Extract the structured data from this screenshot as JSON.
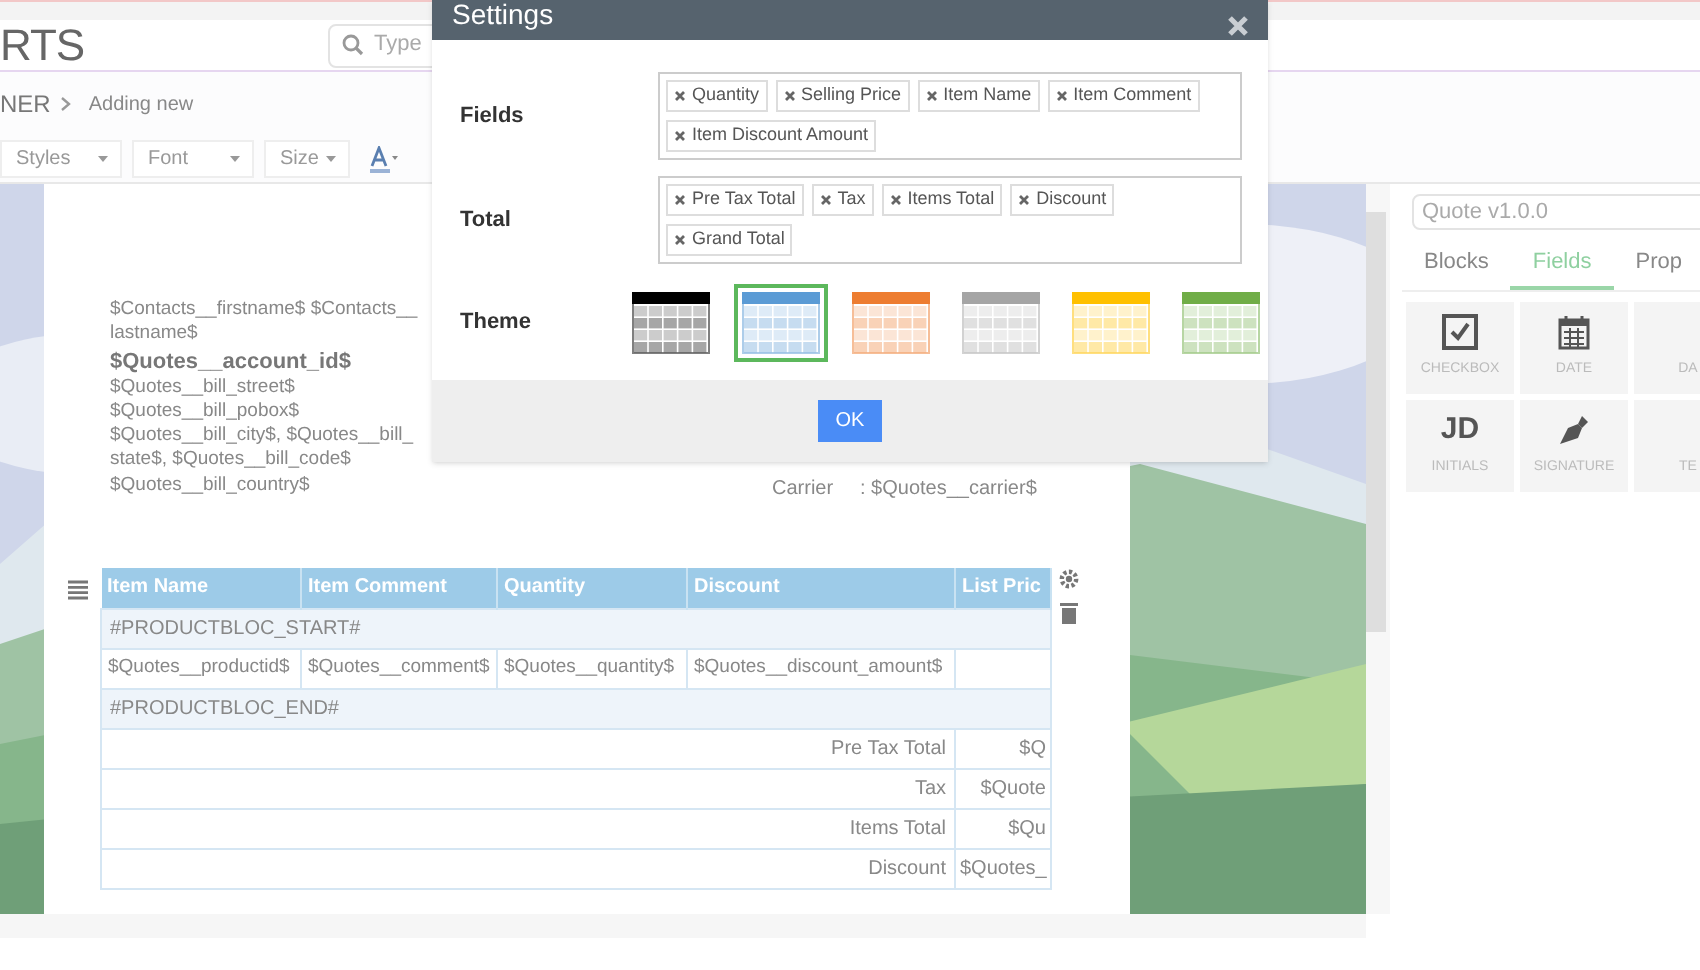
{
  "header": {
    "logo": "RTS",
    "search": {
      "placeholder": "Type"
    }
  },
  "breadcrumb": {
    "parent": "NER",
    "current": "Adding new"
  },
  "toolbar": {
    "dropdowns": [
      "Styles",
      "Font",
      "Size"
    ]
  },
  "document": {
    "address": [
      {
        "text": "$Contacts__firstname$ $Contacts__lastname$",
        "bold": false
      },
      {
        "text": "$Quotes__account_id$",
        "bold": true
      },
      {
        "text": "$Quotes__bill_street$",
        "bold": false
      },
      {
        "text": "$Quotes__bill_pobox$",
        "bold": false
      },
      {
        "text": "$Quotes__bill_city$, $Quotes__bill_state$, $Quotes__bill_code$",
        "bold": false
      },
      {
        "text": "$Quotes__bill_country$",
        "bold": false
      }
    ],
    "details": [
      {
        "label": "Carrier",
        "value": ": $Quotes__carrier$"
      }
    ],
    "table": {
      "columns": [
        "Item Name",
        "Item Comment",
        "Quantity",
        "Discount",
        "List Pric"
      ],
      "rows": [
        {
          "kind": "marker",
          "text": "#PRODUCTBLOC_START#"
        },
        {
          "kind": "data",
          "cells": [
            "$Quotes__productid$",
            "$Quotes__comment$",
            "$Quotes__quantity$",
            "$Quotes__discount_amount$"
          ]
        },
        {
          "kind": "marker",
          "text": "#PRODUCTBLOC_END#"
        },
        {
          "kind": "total",
          "label": "Pre Tax Total",
          "value": "$Q"
        },
        {
          "kind": "total",
          "label": "Tax",
          "value": "$Quote"
        },
        {
          "kind": "total",
          "label": "Items Total",
          "value": "$Qu"
        },
        {
          "kind": "total",
          "label": "Discount",
          "value": "$Quotes_"
        }
      ]
    }
  },
  "panel": {
    "template": "Quote v1.0.0",
    "tabs": [
      {
        "label": "Blocks",
        "selected": false
      },
      {
        "label": "Fields",
        "selected": true
      },
      {
        "label": "Prop",
        "selected": false
      }
    ],
    "tiles": [
      {
        "label": "CHECKBOX",
        "kind": "checkbox"
      },
      {
        "label": "DATE",
        "kind": "calendar"
      },
      {
        "label": "DA",
        "kind": "none"
      },
      {
        "label": "INITIALS",
        "kind": "initials",
        "icon_text": "JD"
      },
      {
        "label": "SIGNATURE",
        "kind": "pen"
      },
      {
        "label": "TE",
        "kind": "none"
      }
    ]
  },
  "settings": {
    "title": "Settings",
    "fields": {
      "label": "Fields",
      "tags": [
        "Quantity",
        "Selling Price",
        "Item Name",
        "Item Comment",
        "Item Discount Amount"
      ]
    },
    "total": {
      "label": "Total",
      "tags": [
        "Pre Tax Total",
        "Tax",
        "Items Total",
        "Discount",
        "Grand Total"
      ]
    },
    "theme": {
      "label": "Theme",
      "themes": [
        {
          "color": "#000000",
          "selected": false
        },
        {
          "color": "#5b9bd5",
          "selected": true
        },
        {
          "color": "#ed7d31",
          "selected": false
        },
        {
          "color": "#a5a5a5",
          "selected": false
        },
        {
          "color": "#ffc000",
          "selected": false
        },
        {
          "color": "#70ad47",
          "selected": false
        }
      ]
    },
    "ok": "OK"
  }
}
